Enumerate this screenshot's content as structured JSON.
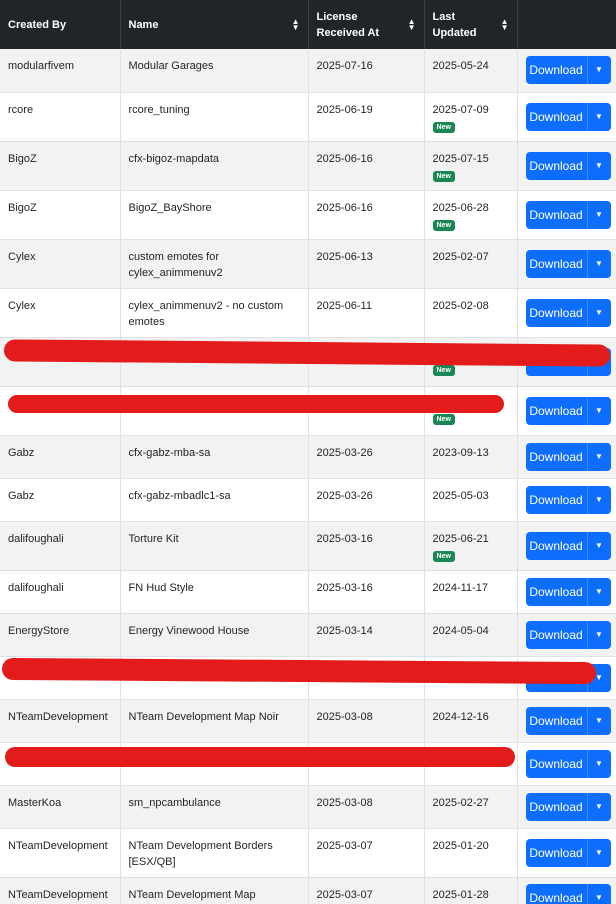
{
  "columns": [
    {
      "label": "Created By",
      "sortable": false
    },
    {
      "label": "Name",
      "sortable": true
    },
    {
      "label": "License Received At",
      "sortable": true
    },
    {
      "label": "Last Updated",
      "sortable": true
    },
    {
      "label": "",
      "sortable": false
    }
  ],
  "sort_icon": "sort-updown-icon",
  "download_label": "Download",
  "new_badge": "New",
  "colors": {
    "header_bg": "#212529",
    "button": "#0d6efd",
    "badge": "#198754",
    "redaction": "#e31b1b"
  },
  "rows": [
    {
      "creator": "modularfivem",
      "name": "Modular Garages",
      "received": "2025-07-16",
      "updated": "2025-05-24",
      "new": false
    },
    {
      "creator": "rcore",
      "name": "rcore_tuning",
      "received": "2025-06-19",
      "updated": "2025-07-09",
      "new": true
    },
    {
      "creator": "BigoZ",
      "name": "cfx-bigoz-mapdata",
      "received": "2025-06-16",
      "updated": "2025-07-15",
      "new": true
    },
    {
      "creator": "BigoZ",
      "name": "BigoZ_BayShore",
      "received": "2025-06-16",
      "updated": "2025-06-28",
      "new": true
    },
    {
      "creator": "Cylex",
      "name": "custom emotes for cylex_animmenuv2",
      "received": "2025-06-13",
      "updated": "2025-02-07",
      "new": false
    },
    {
      "creator": "Cylex",
      "name": "cylex_animmenuv2 - no custom emotes",
      "received": "2025-06-11",
      "updated": "2025-02-08",
      "new": false
    },
    {
      "creator": "",
      "name": "",
      "received": "",
      "updated": "",
      "new": true
    },
    {
      "creator": "",
      "name": "",
      "received": "",
      "updated": "",
      "new": true
    },
    {
      "creator": "Gabz",
      "name": "cfx-gabz-mba-sa",
      "received": "2025-03-26",
      "updated": "2023-09-13",
      "new": false
    },
    {
      "creator": "Gabz",
      "name": "cfx-gabz-mbadlc1-sa",
      "received": "2025-03-26",
      "updated": "2025-05-03",
      "new": false
    },
    {
      "creator": "dalifoughali",
      "name": "Torture Kit",
      "received": "2025-03-16",
      "updated": "2025-06-21",
      "new": true
    },
    {
      "creator": "dalifoughali",
      "name": "FN Hud Style",
      "received": "2025-03-16",
      "updated": "2024-11-17",
      "new": false
    },
    {
      "creator": "EnergyStore",
      "name": "Energy Vinewood House",
      "received": "2025-03-14",
      "updated": "2024-05-04",
      "new": false
    },
    {
      "creator": "",
      "name": "",
      "received": "",
      "updated": "",
      "new": false
    },
    {
      "creator": "NTeamDevelopment",
      "name": "NTeam Development Map Noir",
      "received": "2025-03-08",
      "updated": "2024-12-16",
      "new": false
    },
    {
      "creator": "",
      "name": "",
      "received": "",
      "updated": "",
      "new": false
    },
    {
      "creator": "MasterKoa",
      "name": "sm_npcambulance",
      "received": "2025-03-08",
      "updated": "2025-02-27",
      "new": false
    },
    {
      "creator": "NTeamDevelopment",
      "name": "NTeam Development Borders [ESX/QB]",
      "received": "2025-03-07",
      "updated": "2025-01-20",
      "new": false
    },
    {
      "creator": "NTeamDevelopment",
      "name": "NTeam Development Map Monorail",
      "received": "2025-03-07",
      "updated": "2025-01-28",
      "new": false
    }
  ]
}
